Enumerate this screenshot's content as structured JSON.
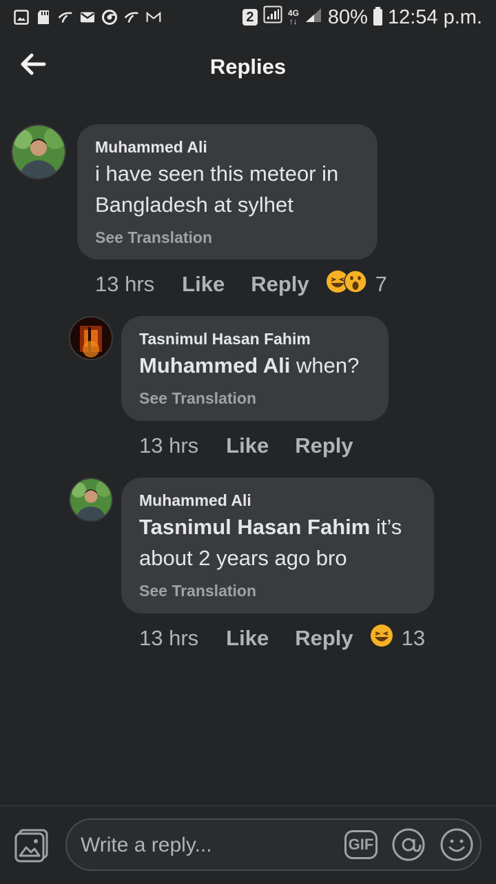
{
  "status_bar": {
    "left_icons": [
      "gallery-icon",
      "sd-card-icon",
      "telenor-icon",
      "mail-icon",
      "chrome-icon",
      "telenor-icon-2",
      "gmail-icon"
    ],
    "sim": "2",
    "network_type": "4G",
    "battery": "80%",
    "time": "12:54 p.m."
  },
  "header": {
    "title": "Replies"
  },
  "comments": [
    {
      "author": "Muhammed Ali",
      "text": "i have seen this meteor in Bangladesh at sylhet",
      "see_translation": "See Translation",
      "time": "13 hrs",
      "like": "Like",
      "reply": "Reply",
      "reactions": [
        "laughing-emoji",
        "wow-emoji"
      ],
      "reaction_count": "7"
    },
    {
      "author": "Tasnimul Hasan Fahim",
      "mention": "Muhammed Ali",
      "text": "when?",
      "see_translation": "See Translation",
      "time": "13 hrs",
      "like": "Like",
      "reply": "Reply"
    },
    {
      "author": "Muhammed Ali",
      "mention": "Tasnimul Hasan Fahim",
      "text": "it’s about 2 years ago bro",
      "see_translation": "See Translation",
      "time": "13 hrs",
      "like": "Like",
      "reply": "Reply",
      "reactions": [
        "laughing-emoji"
      ],
      "reaction_count": "13"
    }
  ],
  "composer": {
    "placeholder": "Write a reply...",
    "gif_label": "GIF"
  },
  "colors": {
    "background": "#242526",
    "bubble": "#3a3b3c",
    "secondary_text": "#b0b3b8",
    "reaction_yellow": "#f7b125"
  }
}
